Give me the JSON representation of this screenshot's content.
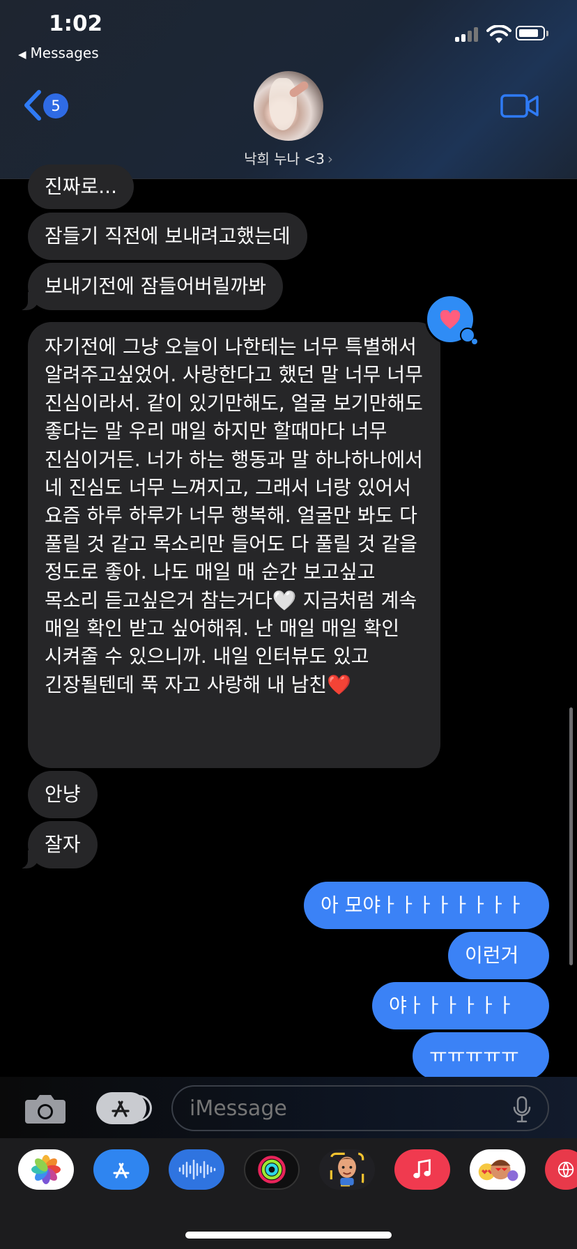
{
  "status_bar": {
    "time": "1:02",
    "back_app_label": "Messages"
  },
  "header": {
    "unread_count": "5",
    "contact_name": "낙희 누나 <3",
    "contact_chevron": "›"
  },
  "messages": [
    {
      "side": "in",
      "text": "진짜로..."
    },
    {
      "side": "in",
      "text": "잠들기 직전에 보내려고했는데"
    },
    {
      "side": "in",
      "text": "보내기전에 잠들어버릴까봐"
    },
    {
      "side": "in",
      "text": "자기전에 그냥 오늘이 나한테는 너무 특별해서 알려주고싶었어. 사랑한다고 했던 말 너무 너무 진심이라서. 같이 있기만해도, 얼굴 보기만해도 좋다는 말 우리 매일 하지만 할때마다 너무 진심이거든. 너가 하는 행동과 말 하나하나에서 네 진심도 너무 느껴지고, 그래서 너랑 있어서 요즘 하루 하루가 너무 행복해. 얼굴만 봐도 다 풀릴 것 같고 목소리만 들어도 다 풀릴 것 같을 정도로 좋아. 나도 매일 매 순간 보고싶고 목소리 듣고싶은거 참는거다🤍 지금처럼 계속 매일 확인 받고 싶어해줘. 난 매일 매일 확인 시켜줄 수 있으니까. 내일 인터뷰도 있고 긴장될텐데 푹 자고 사랑해 내 남친❤️"
    },
    {
      "side": "in",
      "text": "안냥"
    },
    {
      "side": "in",
      "text": "잘자"
    },
    {
      "side": "out",
      "text": "아 모야ㅏㅏㅏㅏㅏㅏㅏㅏ"
    },
    {
      "side": "out",
      "text": "이런거"
    },
    {
      "side": "out",
      "text": "야ㅏㅏㅏㅏㅏㅏ"
    },
    {
      "side": "out",
      "text": "ㅠㅠㅠㅠㅠ"
    }
  ],
  "tapback": {
    "icon": "heart-icon",
    "color": "#ff5e7e"
  },
  "composer": {
    "placeholder": "iMessage"
  },
  "app_strip": [
    "photos-app-icon",
    "appstore-app-icon",
    "audio-message-icon",
    "activity-app-icon",
    "memoji-app-icon",
    "music-app-icon",
    "animoji-stickers-icon",
    "web-search-icon"
  ],
  "colors": {
    "outgoing": "#3b82f6",
    "incoming": "#262628",
    "accent": "#2f6be4"
  }
}
